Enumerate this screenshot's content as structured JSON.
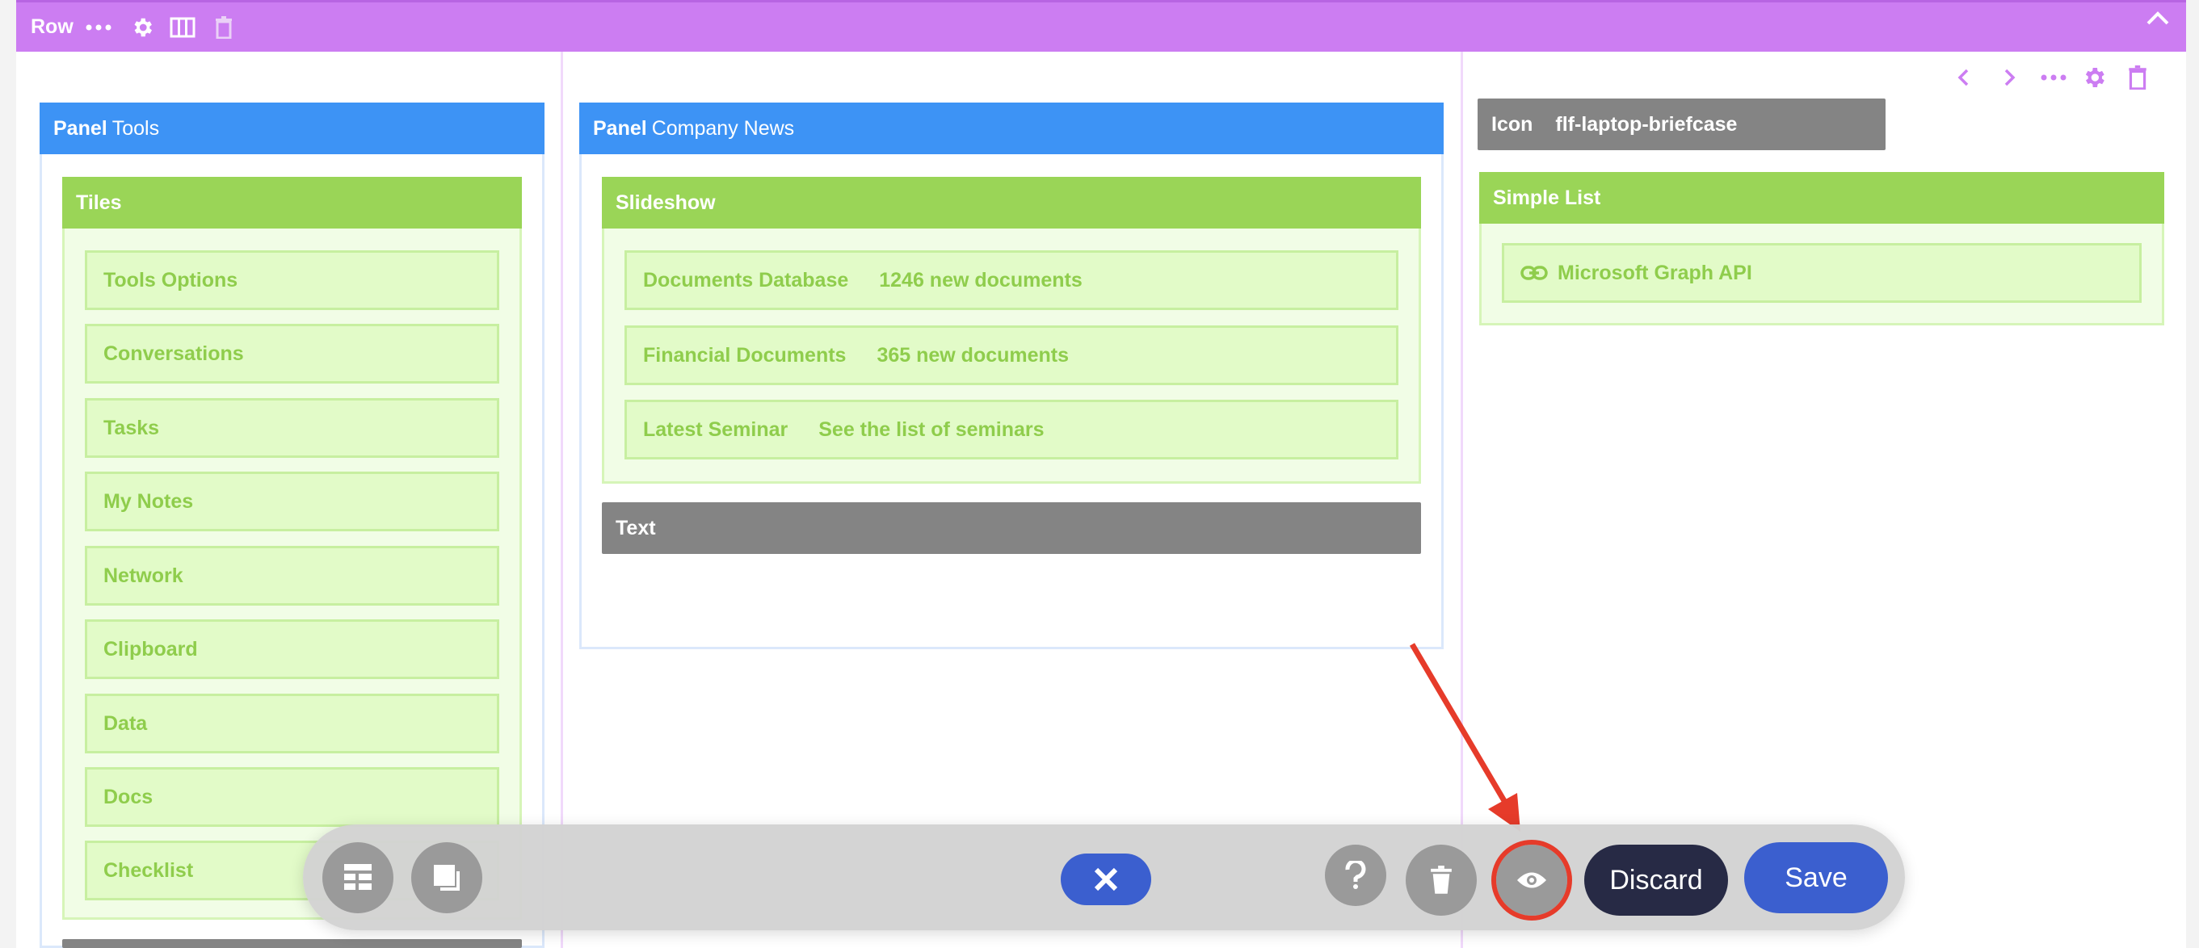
{
  "row": {
    "label": "Row"
  },
  "panels": [
    {
      "prefix": "Panel",
      "title": "Tools"
    },
    {
      "prefix": "Panel",
      "title": "Company News"
    }
  ],
  "tiles": {
    "label": "Tiles",
    "items": [
      "Tools Options",
      "Conversations",
      "Tasks",
      "My Notes",
      "Network",
      "Clipboard",
      "Data",
      "Docs",
      "Checklist"
    ]
  },
  "slideshow": {
    "label": "Slideshow",
    "items": [
      {
        "title": "Documents Database",
        "subtitle": "1246 new documents"
      },
      {
        "title": "Financial Documents",
        "subtitle": "365 new documents"
      },
      {
        "title": "Latest Seminar",
        "subtitle": "See the list of seminars"
      }
    ]
  },
  "text_block": {
    "label": "Text"
  },
  "icon_block": {
    "label": "Icon",
    "value": "flf-laptop-briefcase"
  },
  "simple_list": {
    "label": "Simple List",
    "items": [
      "Microsoft Graph API"
    ]
  },
  "toolbar": {
    "discard_label": "Discard",
    "save_label": "Save"
  },
  "icons": {
    "row": [
      "more-icon",
      "gear-icon",
      "columns-icon",
      "trash-icon",
      "chevron-up-icon"
    ],
    "column": [
      "chevron-left-icon",
      "chevron-right-icon",
      "more-icon",
      "gear-icon",
      "trash-icon"
    ],
    "toolbar": [
      "layout-icon",
      "copy-icon",
      "close-icon",
      "help-icon",
      "trash-icon",
      "eye-icon"
    ]
  },
  "colors": {
    "row": "#cc7df2",
    "panel": "#3d93f5",
    "green": "#9ad557",
    "gray": "#848484",
    "primary": "#3b5fcf",
    "discard": "#272a45",
    "highlight": "#e63b2a"
  }
}
